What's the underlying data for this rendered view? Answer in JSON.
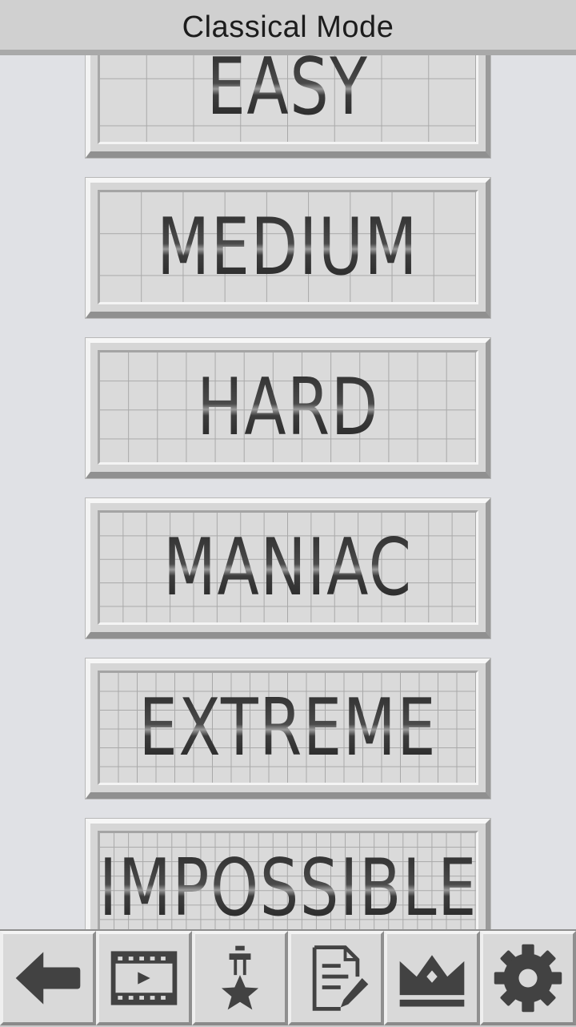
{
  "header": {
    "title": "Classical Mode"
  },
  "levels": [
    {
      "label": "EASY",
      "grid_cells": 8
    },
    {
      "label": "MEDIUM",
      "grid_cells": 9
    },
    {
      "label": "HARD",
      "grid_cells": 13
    },
    {
      "label": "MANIAC",
      "grid_cells": 16
    },
    {
      "label": "EXTREME",
      "grid_cells": 20
    },
    {
      "label": "IMPOSSIBLE",
      "grid_cells": 26
    }
  ],
  "toolbar": [
    {
      "icon": "back-arrow-icon"
    },
    {
      "icon": "video-film-icon"
    },
    {
      "icon": "achievement-star-icon"
    },
    {
      "icon": "notes-edit-icon"
    },
    {
      "icon": "crown-leaderboard-icon"
    },
    {
      "icon": "settings-gear-icon"
    }
  ],
  "colors": {
    "background": "#e0e1e5",
    "button": "#d6d6d6",
    "icon": "#424242"
  }
}
